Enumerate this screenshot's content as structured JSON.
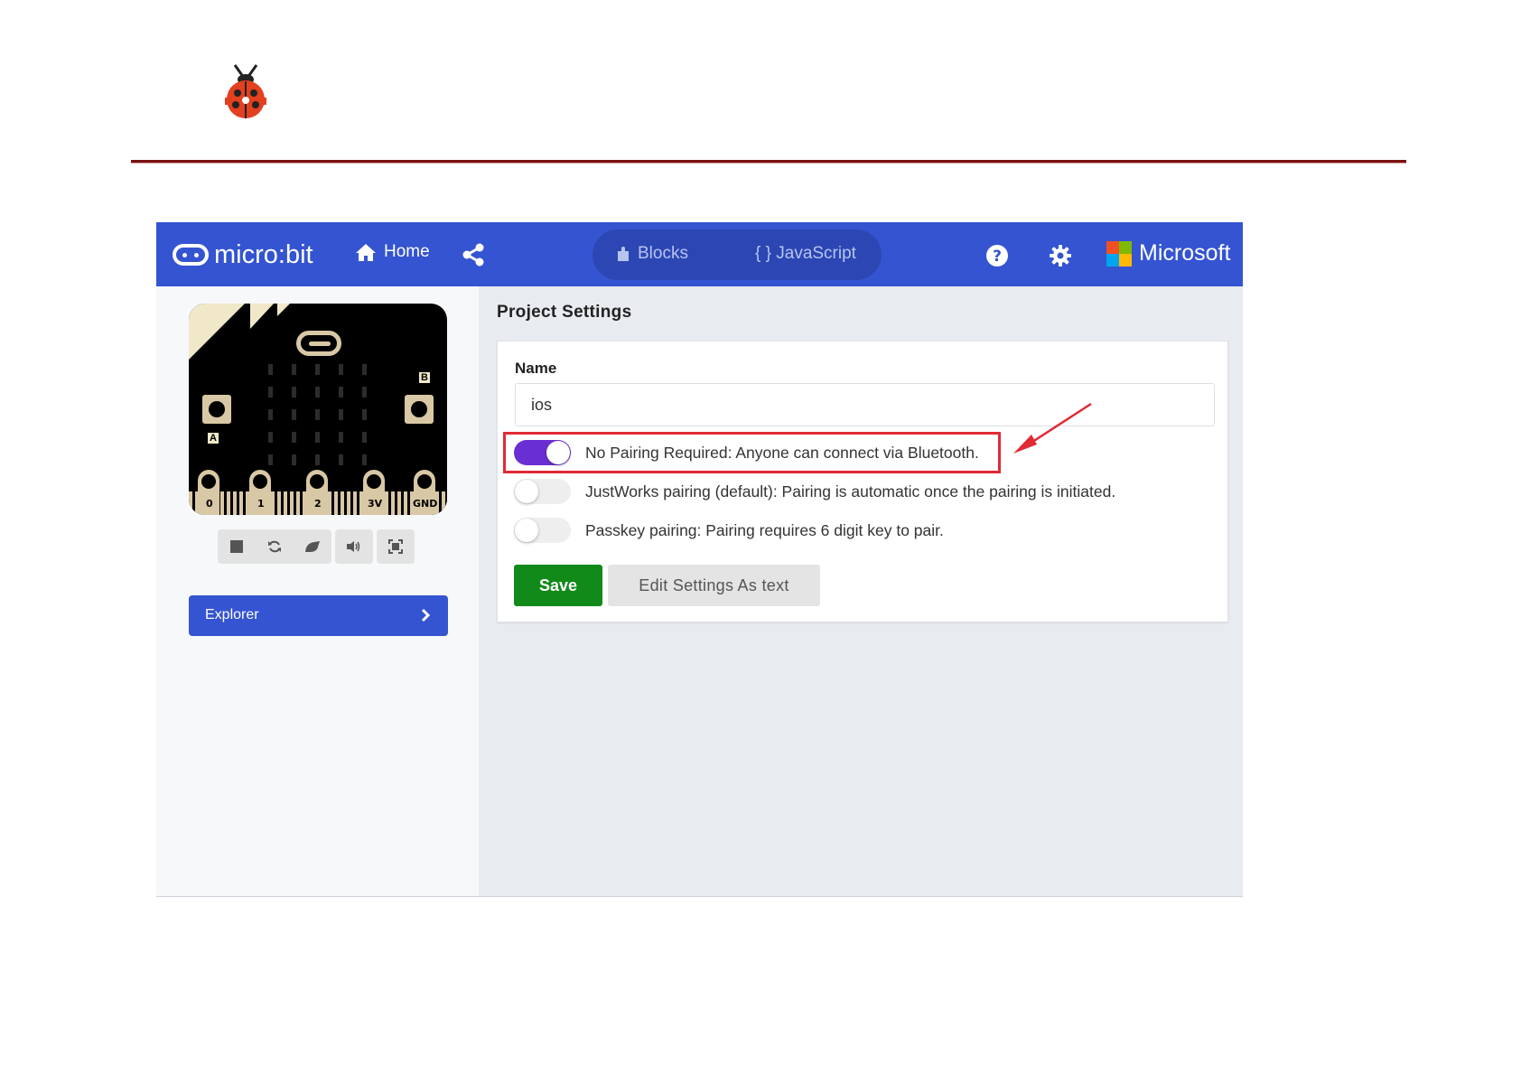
{
  "header": {
    "brand": "micro:bit",
    "home_label": "Home",
    "tabs": [
      {
        "label": "Blocks",
        "icon": "puzzle-icon"
      },
      {
        "label": "{ }  JavaScript",
        "icon": "braces-icon"
      }
    ],
    "microsoft_label": "Microsoft"
  },
  "simulator": {
    "pin_labels": [
      "0",
      "1",
      "2",
      "3V",
      "GND"
    ],
    "button_labels": [
      "A",
      "B"
    ],
    "controls": [
      "stop-icon",
      "restart-icon",
      "debug-icon",
      "sound-icon",
      "fullscreen-icon"
    ]
  },
  "sidebar": {
    "explorer_label": "Explorer"
  },
  "settings": {
    "title": "Project Settings",
    "name_label": "Name",
    "name_value": "ios",
    "options": [
      {
        "label": "No Pairing Required: Anyone can connect via Bluetooth.",
        "enabled": true
      },
      {
        "label": "JustWorks pairing (default): Pairing is automatic once the pairing is initiated.",
        "enabled": false
      },
      {
        "label": "Passkey pairing: Pairing requires 6 digit key to pair.",
        "enabled": false
      }
    ],
    "save_label": "Save",
    "edit_text_label": "Edit Settings As text"
  },
  "colors": {
    "header_blue": "#3454d1",
    "toggle_on": "#6a2fd2",
    "save_green": "#118a1a",
    "highlight_red": "#e02a36"
  }
}
